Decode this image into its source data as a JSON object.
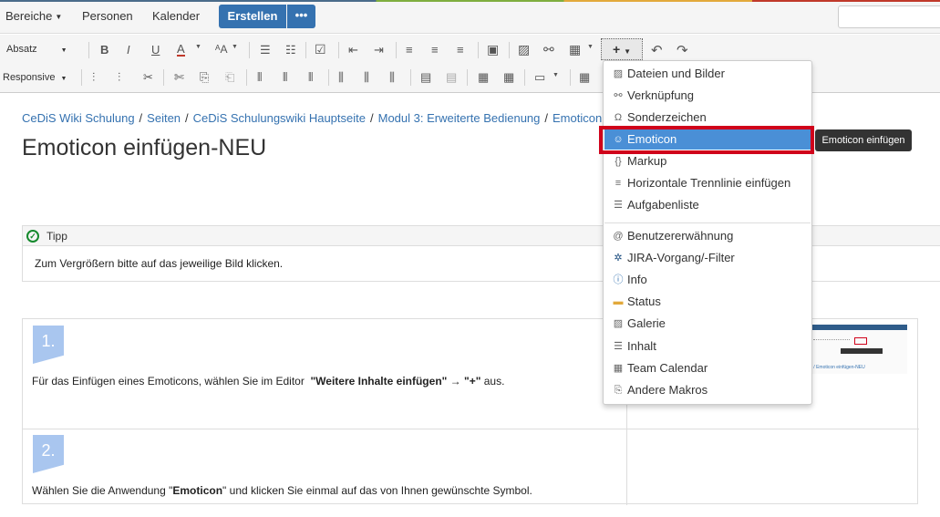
{
  "header": {
    "nav": [
      "Bereiche",
      "Personen",
      "Kalender"
    ],
    "create_label": "Erstellen",
    "more_label": "•••",
    "search_placeholder": ""
  },
  "toolbar": {
    "paragraph_select": "Absatz",
    "responsive_select": "Responsive",
    "bold": "B",
    "italic": "I",
    "underline": "U",
    "text_color": "A",
    "more_format": "ᴬA",
    "plus": "+",
    "caret": "▾"
  },
  "breadcrumb": [
    "CeDiS Wiki Schulung",
    "Seiten",
    "CeDiS Schulungswiki Hauptseite",
    "Modul 3: Erweiterte Bedienung",
    "Emoticon einfügen-NEU"
  ],
  "page": {
    "title": "Emoticon einfügen-NEU"
  },
  "tip": {
    "title": "Tipp",
    "body": "Zum Vergrößern bitte auf das jeweilige Bild klicken."
  },
  "steps": [
    {
      "number": "1.",
      "pre": "Für das Einfügen eines Emoticons, wählen Sie im Editor  ",
      "bold": "\"Weitere Inhalte einfügen\"",
      "arrow": " → ",
      "bold2": "\"+\"",
      "post": " aus."
    },
    {
      "number": "2.",
      "pre": "Wählen Sie die Anwendung \"",
      "bold": "Emoticon",
      "post": "\" und klicken Sie einmal auf das von Ihnen gewünschte Symbol."
    }
  ],
  "thumbnail": {
    "breadcrumb_text": "Bedienung / Emoticon einfügen-NEU"
  },
  "insert_menu": {
    "items": [
      {
        "label": "Dateien und Bilder",
        "icon": "image-icon"
      },
      {
        "label": "Verknüpfung",
        "icon": "link-icon"
      },
      {
        "label": "Sonderzeichen",
        "icon": "omega-icon"
      },
      {
        "label": "Emoticon",
        "icon": "smiley-icon"
      },
      {
        "label": "Markup",
        "icon": "braces-icon"
      },
      {
        "label": "Horizontale Trennlinie einfügen",
        "icon": "horizontal-rule-icon"
      },
      {
        "label": "Aufgabenliste",
        "icon": "task-list-icon"
      },
      {
        "label": "Benutzererwähnung",
        "icon": "at-icon"
      },
      {
        "label": "JIRA-Vorgang/-Filter",
        "icon": "jira-icon"
      },
      {
        "label": "Info",
        "icon": "info-icon"
      },
      {
        "label": "Status",
        "icon": "status-icon"
      },
      {
        "label": "Galerie",
        "icon": "gallery-icon"
      },
      {
        "label": "Inhalt",
        "icon": "toc-icon"
      },
      {
        "label": "Team Calendar",
        "icon": "calendar-icon"
      },
      {
        "label": "Andere Makros",
        "icon": "macro-icon"
      }
    ],
    "tooltip": "Emoticon einfügen"
  },
  "colors": {
    "primary": "#3572b0",
    "menu_highlight": "#4a8fd6",
    "annotation": "#d0021b",
    "tip_green": "#14892c",
    "step_badge": "#a9c6ef"
  }
}
